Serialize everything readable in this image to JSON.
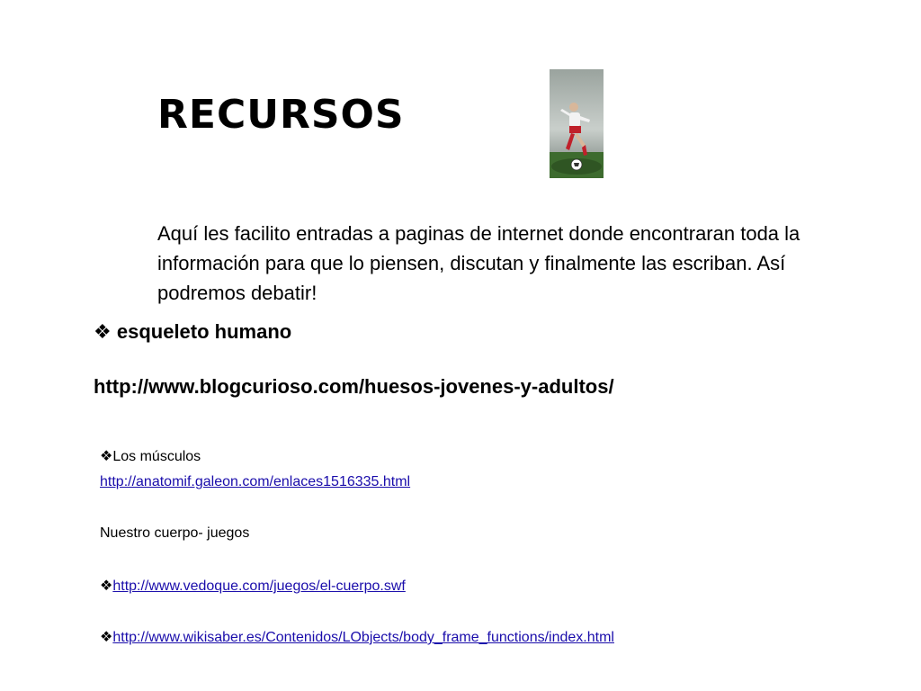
{
  "slide": {
    "title": "RECURSOS",
    "intro": "Aquí les facilito entradas a paginas de internet donde encontraran toda la información para que lo piensen,  discutan y finalmente las escriban. Así podremos debatir!",
    "bullet_glyph": "❖",
    "section1": {
      "label": "esqueleto humano",
      "url": "http://www.blogcurioso.com/huesos-jovenes-y-adultos/"
    },
    "section2": {
      "label": "Los músculos",
      "url": "http://anatomif.galeon.com/enlaces1516335.html"
    },
    "section3": {
      "label": "Nuestro cuerpo- juegos",
      "url1": "http://www.vedoque.com/juegos/el-cuerpo.swf",
      "url2": "http://www.wikisaber.es/Contenidos/LObjects/body_frame_functions/index.html"
    },
    "link_color": "#1a0dab"
  }
}
